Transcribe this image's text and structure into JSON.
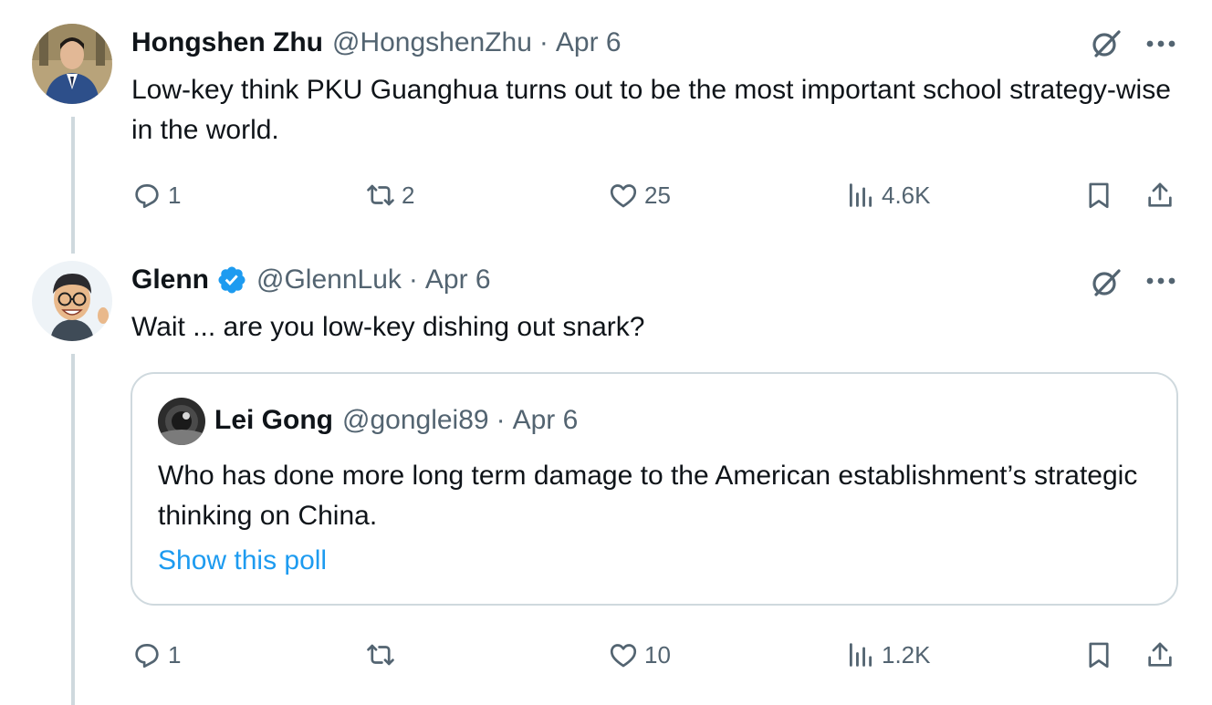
{
  "tweets": [
    {
      "author_name": "Hongshen Zhu",
      "handle": "@HongshenZhu",
      "separator": "·",
      "date": "Apr 6",
      "verified": false,
      "text": "Low-key think PKU Guanghua turns out to be the most important school strategy-wise in the world.",
      "stats": {
        "replies": "1",
        "reposts": "2",
        "likes": "25",
        "views": "4.6K"
      }
    },
    {
      "author_name": "Glenn",
      "handle": "@GlennLuk",
      "separator": "·",
      "date": "Apr 6",
      "verified": true,
      "text": "Wait ... are you low-key dishing out snark?",
      "stats": {
        "replies": "1",
        "reposts": "",
        "likes": "10",
        "views": "1.2K"
      },
      "quote": {
        "author_name": "Lei Gong",
        "handle": "@gonglei89",
        "separator": "·",
        "date": "Apr 6",
        "text": "Who has done more long term damage to the American establishment’s strategic thinking on China.",
        "link_label": "Show this poll"
      }
    }
  ],
  "icons": [
    "reply-icon",
    "repost-icon",
    "like-icon",
    "views-icon",
    "bookmark-icon",
    "share-icon",
    "grok-icon",
    "more-icon",
    "verified-badge-icon"
  ],
  "colors": {
    "text": "#0f1419",
    "muted": "#536471",
    "link": "#1d9bf0",
    "border": "#cfd9de",
    "verified": "#1d9bf0"
  }
}
